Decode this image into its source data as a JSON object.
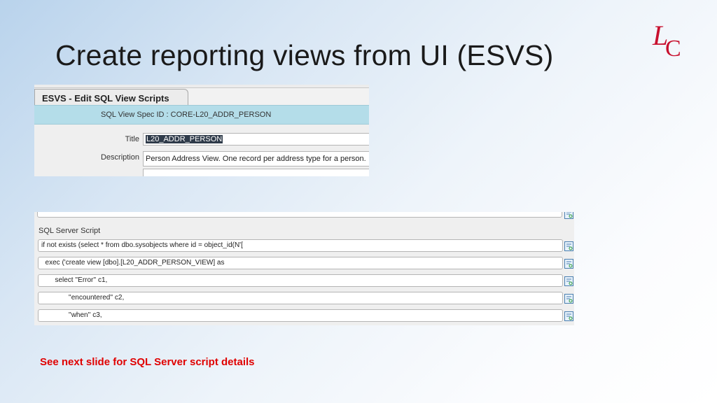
{
  "slide": {
    "title": "Create reporting views from UI (ESVS)",
    "footnote": "See next slide for SQL Server script details",
    "footnote_color": "#e00000",
    "logo_color": "#c8102e"
  },
  "esvs": {
    "tab_label": "ESVS - Edit SQL View Scripts",
    "spec_id_line": "SQL View Spec ID :  CORE-L20_ADDR_PERSON",
    "title_label": "Title",
    "title_value": "L20_ADDR_PERSON",
    "description_label": "Description",
    "description_value": "Person Address View.  One record per address type for a person."
  },
  "sql_script": {
    "header": "SQL Server Script",
    "lines": [
      "if not exists (select * from dbo.sysobjects where id =   object_id(N'[",
      "  exec ('create view [dbo].[L20_ADDR_PERSON_VIEW] as",
      "       select ''Error'' c1,",
      "              ''encountered'' c2,",
      "              ''when'' c3,"
    ],
    "detail_icon": "detail-lookup-icon"
  }
}
